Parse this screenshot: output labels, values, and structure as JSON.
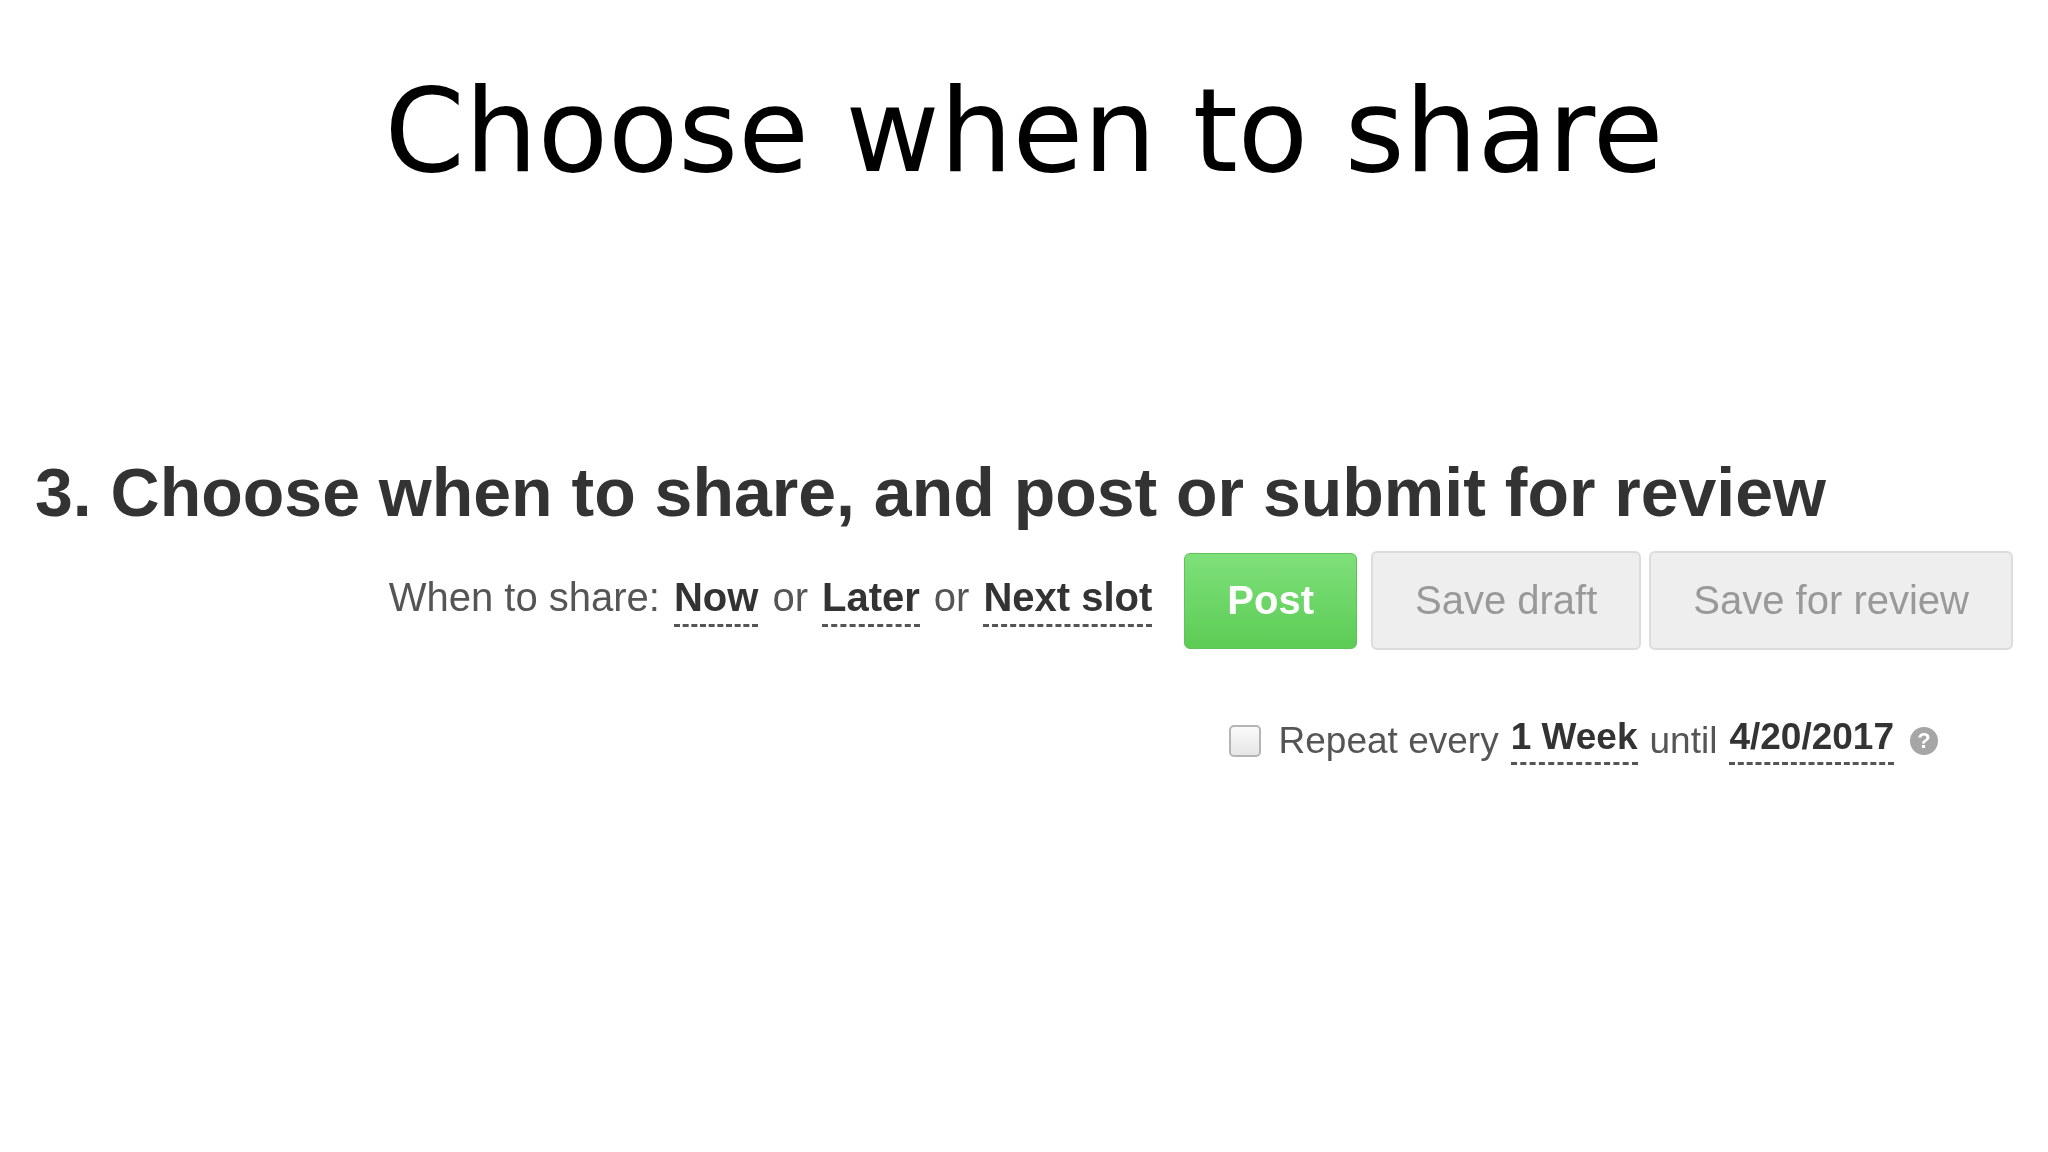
{
  "slide": {
    "title": "Choose when to share"
  },
  "section": {
    "heading": "3. Choose when to share, and post or submit for review",
    "when_to_share": {
      "label": "When to share:",
      "parts": [
        {
          "kind": "link",
          "text": "Now"
        },
        {
          "kind": "text",
          "text": "or"
        },
        {
          "kind": "link",
          "text": "Later"
        },
        {
          "kind": "text",
          "text": "or"
        },
        {
          "kind": "link",
          "text": "Next slot"
        }
      ]
    },
    "buttons": [
      {
        "label": "Post",
        "kind": "primary"
      },
      {
        "label": "Save draft",
        "kind": "secondary"
      },
      {
        "label": "Save for review",
        "kind": "secondary"
      }
    ],
    "repeat": {
      "checked": false,
      "parts": [
        {
          "kind": "text",
          "text": "Repeat every"
        },
        {
          "kind": "link",
          "text": "1 Week"
        },
        {
          "kind": "text",
          "text": "until"
        },
        {
          "kind": "link",
          "text": "4/20/2017"
        }
      ],
      "help": "?"
    }
  }
}
